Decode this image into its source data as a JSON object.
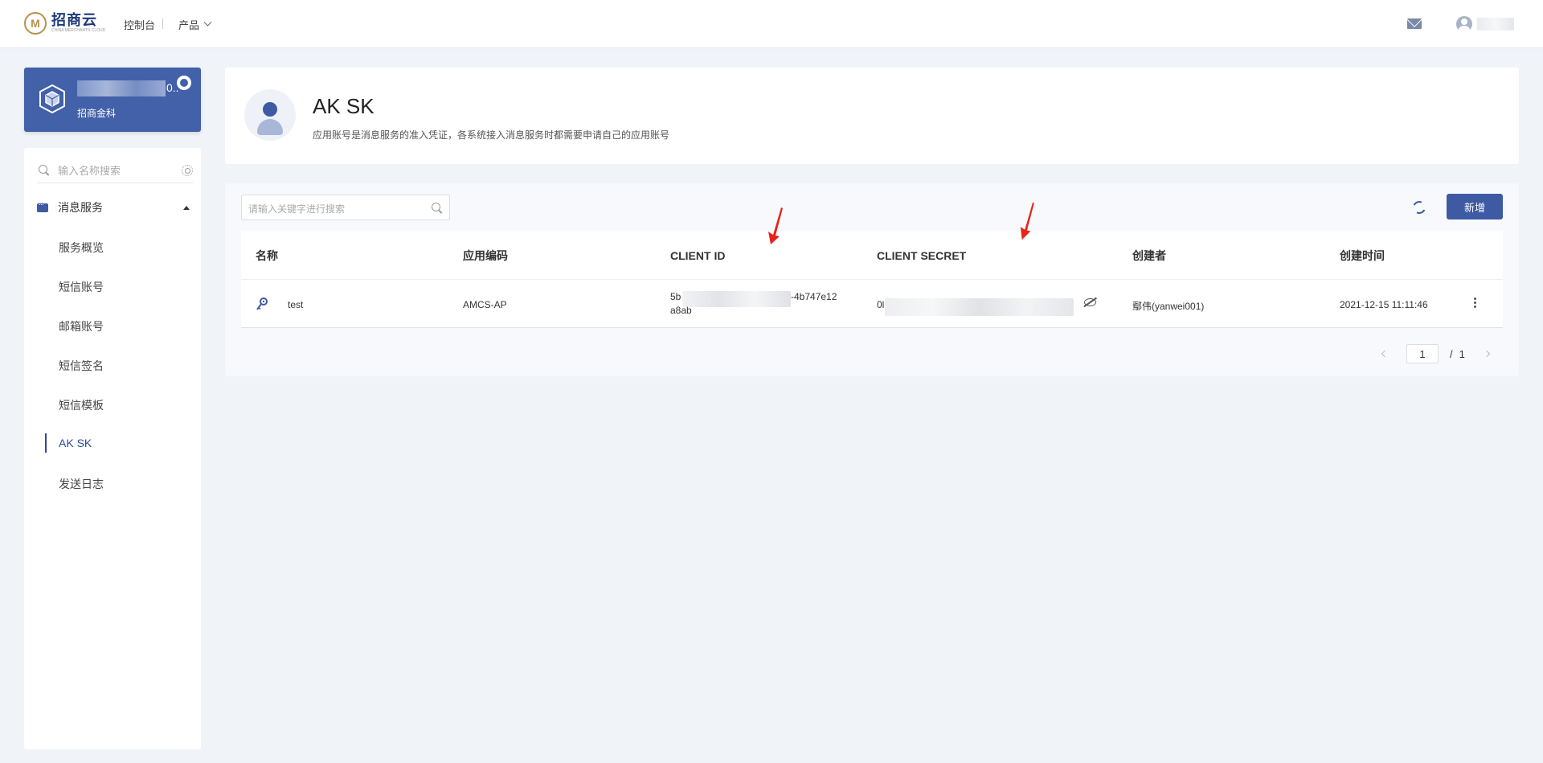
{
  "header": {
    "logo_name": "招商云",
    "logo_sub": "CHINA MERCHANTS CLOUD",
    "console_label": "控制台",
    "products_label": "产品"
  },
  "account": {
    "suffix": "0..",
    "name": "招商金科"
  },
  "sidebar": {
    "search_placeholder": "输入名称搜索",
    "group_label": "消息服务",
    "items": [
      {
        "label": "服务概览"
      },
      {
        "label": "短信账号"
      },
      {
        "label": "邮箱账号"
      },
      {
        "label": "短信签名"
      },
      {
        "label": "短信模板"
      },
      {
        "label": "AK SK"
      },
      {
        "label": "发送日志"
      }
    ]
  },
  "page": {
    "title": "AK SK",
    "description": "应用账号是消息服务的准入凭证，各系统接入消息服务时都需要申请自己的应用账号"
  },
  "toolbar": {
    "search_placeholder": "请输入关键字进行搜索",
    "add_label": "新增"
  },
  "table": {
    "columns": [
      "名称",
      "应用编码",
      "CLIENT ID",
      "CLIENT SECRET",
      "创建者",
      "创建时间"
    ],
    "rows": [
      {
        "name": "test",
        "app_code": "AMCS-AP",
        "client_id_line1_start": "5b",
        "client_id_line1_end": "-4b747e12",
        "client_id_line2": "a8ab",
        "client_secret_start": "0l",
        "creator": "鄢伟(yanwei001)",
        "created_at": "2021-12-15 11:11:46"
      }
    ]
  },
  "pager": {
    "current": "1",
    "separator": "/",
    "total": "1"
  },
  "colors": {
    "brand": "#3e5aa2",
    "card_blue": "#4261a8",
    "annotation_red": "#e8231a"
  }
}
